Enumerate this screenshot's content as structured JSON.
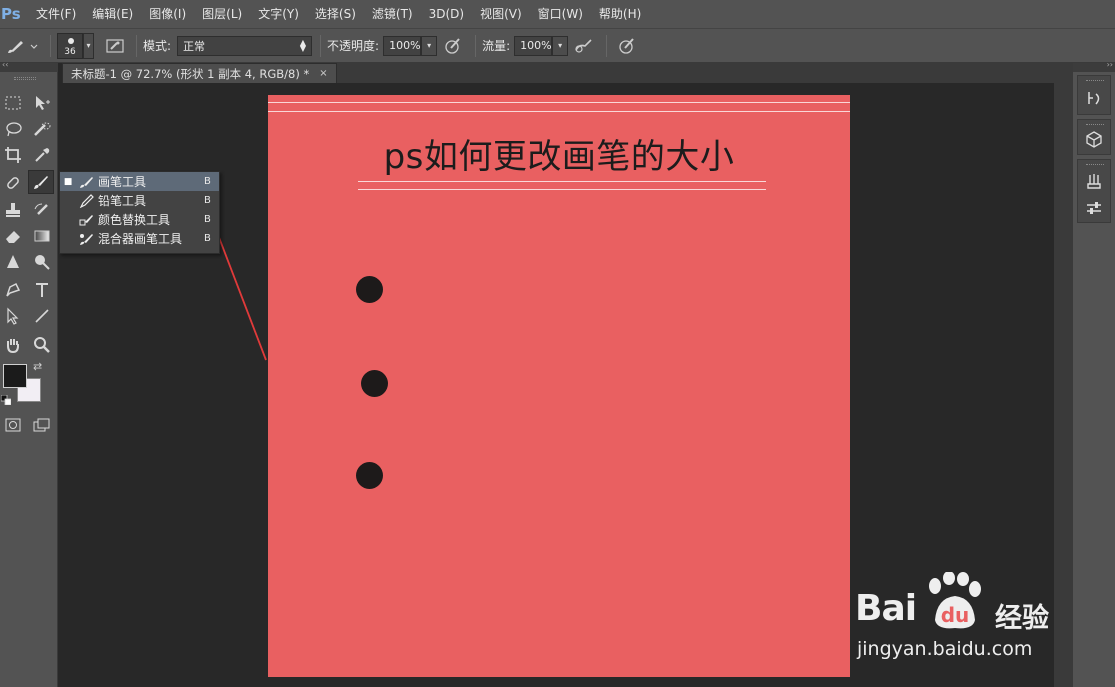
{
  "app": {
    "logo_text": "Ps"
  },
  "menubar": {
    "items": [
      "文件(F)",
      "编辑(E)",
      "图像(I)",
      "图层(L)",
      "文字(Y)",
      "选择(S)",
      "滤镜(T)",
      "3D(D)",
      "视图(V)",
      "窗口(W)",
      "帮助(H)"
    ]
  },
  "options": {
    "brush_size": "36",
    "mode_label": "模式:",
    "mode_value": "正常",
    "opacity_label": "不透明度:",
    "opacity_value": "100%",
    "flow_label": "流量:",
    "flow_value": "100%"
  },
  "document": {
    "tab_title": "未标题-1 @ 72.7% (形状 1 副本 4, RGB/8) *",
    "close_glyph": "×"
  },
  "canvas": {
    "title": "ps如何更改画笔的大小",
    "background_color": "#e96061",
    "dot_color": "#1d1a1a"
  },
  "flyout": {
    "items": [
      {
        "label": "画笔工具",
        "key": "B",
        "selected": true
      },
      {
        "label": "铅笔工具",
        "key": "B",
        "selected": false
      },
      {
        "label": "颜色替换工具",
        "key": "B",
        "selected": false
      },
      {
        "label": "混合器画笔工具",
        "key": "B",
        "selected": false
      }
    ]
  },
  "colors": {
    "foreground": "#1b1b1b",
    "background": "#f2eef4",
    "annotation_arrow": "#e03a3a"
  },
  "watermark": {
    "brand": "Bai",
    "brand_suffix": "du",
    "cn": "经验",
    "url": "jingyan.baidu.com"
  }
}
